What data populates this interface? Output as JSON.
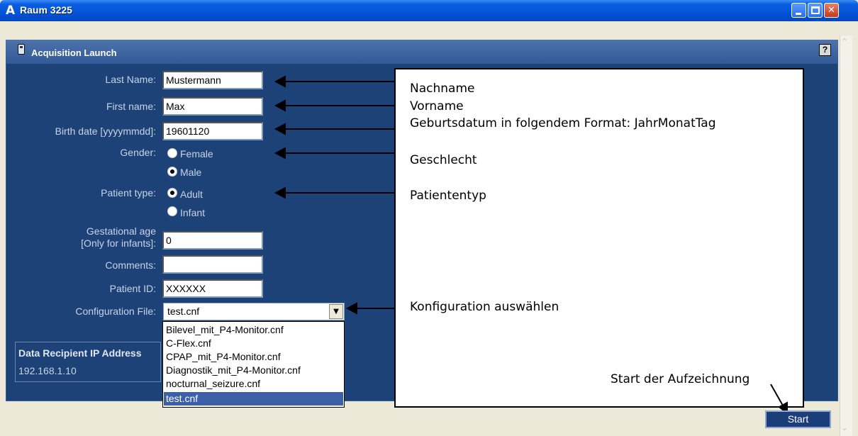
{
  "window": {
    "title": "Raum 3225",
    "icon_glyph": "A"
  },
  "panel": {
    "title": "Acquisition Launch",
    "help_label": "?"
  },
  "form": {
    "last_name_label": "Last Name:",
    "last_name_value": "Mustermann",
    "first_name_label": "First name:",
    "first_name_value": "Max",
    "birth_label": "Birth date [yyyymmdd]:",
    "birth_value": "19601120",
    "gender_label": "Gender:",
    "gender_female": "Female",
    "gender_male": "Male",
    "gender_selected": "Male",
    "patient_type_label": "Patient type:",
    "type_adult": "Adult",
    "type_infant": "Infant",
    "type_selected": "Adult",
    "gest_label_1": "Gestational age",
    "gest_label_2": "[Only for infants]:",
    "gest_value": "0",
    "comments_label": "Comments:",
    "comments_value": "",
    "patient_id_label": "Patient ID:",
    "patient_id_value": "XXXXXX",
    "config_label": "Configuration File:",
    "config_value": "test.cnf"
  },
  "config_options": [
    "Bilevel_mit_P4-Monitor.cnf",
    "C-Flex.cnf",
    "CPAP_mit_P4-Monitor.cnf",
    "Diagnostik_mit_P4-Monitor.cnf",
    "nocturnal_seizure.cnf",
    "test.cnf"
  ],
  "ip": {
    "title": "Data Recipient IP Address",
    "value": "192.168.1.10"
  },
  "annotations": {
    "nachname": "Nachname",
    "vorname": "Vorname",
    "geburtsdatum": "Geburtsdatum in folgendem Format: JahrMonatTag",
    "geschlecht": "Geschlecht",
    "patiententyp": "Patiententyp",
    "konfiguration": "Konfiguration auswählen",
    "start": "Start der Aufzeichnung"
  },
  "start_button": "Start"
}
